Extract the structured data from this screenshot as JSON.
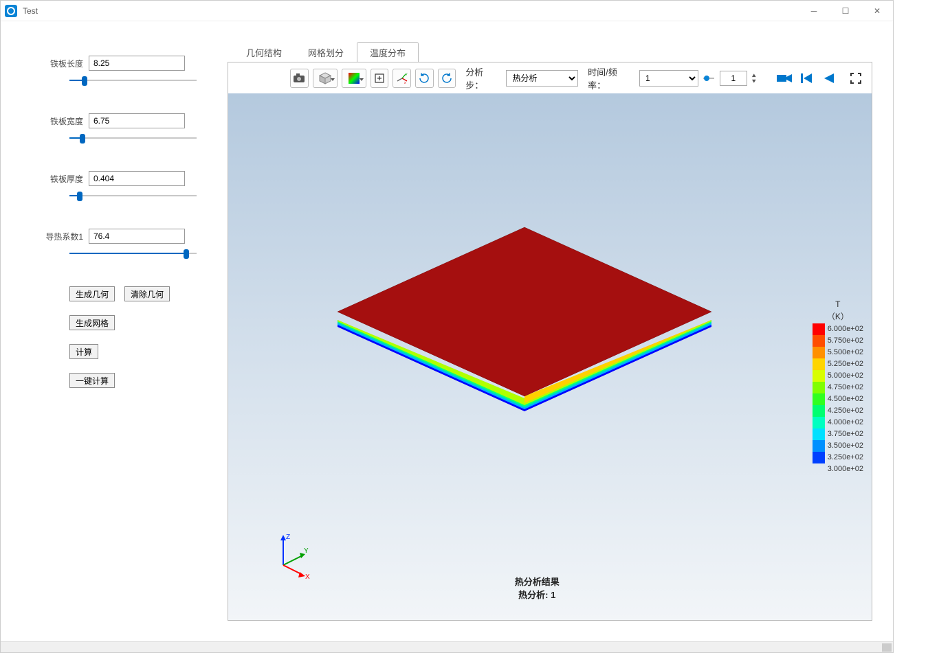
{
  "window": {
    "title": "Test"
  },
  "params": [
    {
      "label": "铁板长度",
      "value": "8.25",
      "fill_pct": 12
    },
    {
      "label": "铁板宽度",
      "value": "6.75",
      "fill_pct": 10
    },
    {
      "label": "铁板厚度",
      "value": "0.404",
      "fill_pct": 8
    },
    {
      "label": "导热系数1",
      "value": "76.4",
      "fill_pct": 92
    }
  ],
  "buttons": {
    "gen_geom": "生成几何",
    "clr_geom": "清除几何",
    "gen_mesh": "生成网格",
    "compute": "计算",
    "one_click": "一键计算"
  },
  "tabs": [
    {
      "label": "几何结构",
      "active": false
    },
    {
      "label": "网格划分",
      "active": false
    },
    {
      "label": "温度分布",
      "active": true
    }
  ],
  "toolbar": {
    "step_label": "分析步：",
    "step_value": "热分析",
    "time_label": "时间/频率：",
    "time_value": "1",
    "frame_value": "1"
  },
  "result": {
    "line1": "热分析结果",
    "line2": "热分析: 1"
  },
  "axes": {
    "x": "X",
    "y": "Y",
    "z": "Z"
  },
  "legend": {
    "title1": "T",
    "title2": "（K）",
    "entries": [
      {
        "label": "6.000e+02",
        "color": "#ff0000"
      },
      {
        "label": "5.750e+02",
        "color": "#ff4d00"
      },
      {
        "label": "5.500e+02",
        "color": "#ff9000"
      },
      {
        "label": "5.250e+02",
        "color": "#ffd500"
      },
      {
        "label": "5.000e+02",
        "color": "#d8ff00"
      },
      {
        "label": "4.750e+02",
        "color": "#80ff00"
      },
      {
        "label": "4.500e+02",
        "color": "#30ff20"
      },
      {
        "label": "4.250e+02",
        "color": "#00ff70"
      },
      {
        "label": "4.000e+02",
        "color": "#00ffc0"
      },
      {
        "label": "3.750e+02",
        "color": "#00e0ff"
      },
      {
        "label": "3.500e+02",
        "color": "#0090ff"
      },
      {
        "label": "3.250e+02",
        "color": "#0040ff"
      },
      {
        "label": "3.000e+02",
        "color": "#0000ff"
      }
    ]
  }
}
